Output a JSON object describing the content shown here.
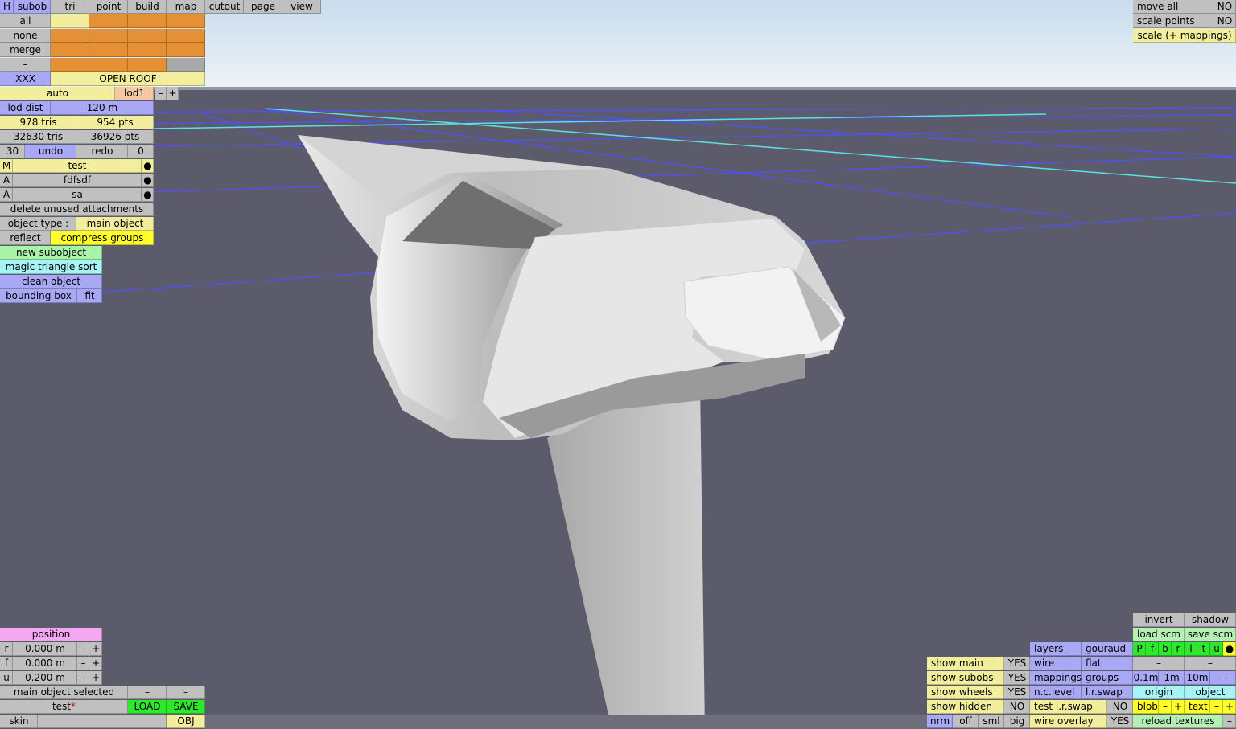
{
  "colors": {
    "sky_top": "#c9dcee",
    "ground": "#5b5b6b",
    "grid": "#5050ff",
    "grid_accent": "#5ce0e0",
    "orange": "#e69035",
    "lavender": "#a8a8f4",
    "yellow": "#f2ee9c",
    "green": "#a8f4a8"
  },
  "menu": {
    "h": "H",
    "tabs": [
      "subob",
      "tri",
      "point",
      "build",
      "map",
      "cutout",
      "page",
      "view"
    ]
  },
  "select": {
    "all": "all",
    "none": "none",
    "merge": "merge",
    "minus": "–"
  },
  "roof": {
    "xxx": "XXX",
    "open_roof": "OPEN ROOF"
  },
  "lod": {
    "auto": "auto",
    "lod": "lod1",
    "minus": "–",
    "plus": "+",
    "dist_label": "lod dist",
    "dist_value": "120 m",
    "tris": "978 tris",
    "pts": "954 pts",
    "total_tris": "32630 tris",
    "total_pts": "36926 pts"
  },
  "history": {
    "count": "30",
    "undo": "undo",
    "redo": "redo",
    "redo_count": "0"
  },
  "attachments": [
    {
      "tag": "M",
      "name": "test",
      "dot": "●"
    },
    {
      "tag": "A",
      "name": "fdfsdf",
      "dot": "●"
    },
    {
      "tag": "A",
      "name": "sa",
      "dot": "●"
    }
  ],
  "actions": {
    "delete_unused": "delete unused attachments",
    "object_type_label": "object type :",
    "object_type_value": "main object",
    "reflect": "reflect",
    "compress_groups": "compress groups",
    "new_subobject": "new subobject",
    "magic_sort": "magic triangle sort",
    "clean_object": "clean object",
    "bounding_box": "bounding box",
    "fit": "fit"
  },
  "top_right": {
    "move_all": "move all",
    "move_all_val": "NO",
    "scale_points": "scale points",
    "scale_points_val": "NO",
    "scale_mappings": "scale (+ mappings)"
  },
  "position": {
    "title": "position",
    "rows": [
      {
        "axis": "r",
        "value": "0.000 m"
      },
      {
        "axis": "f",
        "value": "0.000 m"
      },
      {
        "axis": "u",
        "value": "0.200 m"
      }
    ],
    "minus": "–",
    "plus": "+"
  },
  "bottom_left": {
    "status": "main object selected",
    "dash": "–",
    "file": "test",
    "modified_mark": "*",
    "load": "LOAD",
    "save": "SAVE",
    "skin": "skin",
    "obj": "OBJ"
  },
  "show": [
    {
      "label": "show main",
      "value": "YES"
    },
    {
      "label": "show subobs",
      "value": "YES"
    },
    {
      "label": "show wheels",
      "value": "YES"
    },
    {
      "label": "show hidden",
      "value": "NO"
    }
  ],
  "size_modes": [
    "nrm",
    "off",
    "sml",
    "big"
  ],
  "render": {
    "layers": "layers",
    "gouraud": "gouraud",
    "wire": "wire",
    "flat": "flat",
    "mappings": "mappings",
    "groups": "groups",
    "nc_level": "n.c.level",
    "lr_swap": "l.r.swap",
    "test_lr_swap": "test l.r.swap",
    "test_lr_val": "NO",
    "wire_overlay": "wire overlay",
    "wire_overlay_val": "YES"
  },
  "right_panel": {
    "invert": "invert",
    "shadow": "shadow",
    "load_scm": "load scm",
    "save_scm": "save scm",
    "letters": [
      "P",
      "f",
      "b",
      "r",
      "l",
      "t",
      "u"
    ],
    "dot": "●",
    "dash": "–",
    "steps": [
      "0.1m",
      "1m",
      "10m"
    ],
    "origin": "origin",
    "object": "object",
    "blob": "blob",
    "text": "text",
    "minus": "–",
    "plus": "+",
    "reload": "reload textures"
  }
}
